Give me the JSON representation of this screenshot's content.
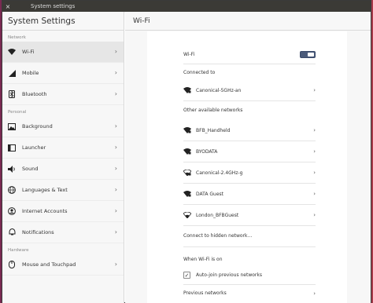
{
  "window": {
    "title": "System settings",
    "close_glyph": "×"
  },
  "left_panel": {
    "title": "System Settings",
    "sections": [
      {
        "label": "Network",
        "items": [
          {
            "label": "Wi-Fi",
            "icon": "wifi-icon",
            "selected": true
          },
          {
            "label": "Mobile",
            "icon": "signal-bars-icon"
          },
          {
            "label": "Bluetooth",
            "icon": "bluetooth-icon"
          }
        ]
      },
      {
        "label": "Personal",
        "items": [
          {
            "label": "Background",
            "icon": "image-icon"
          },
          {
            "label": "Launcher",
            "icon": "launcher-icon"
          },
          {
            "label": "Sound",
            "icon": "speaker-icon"
          },
          {
            "label": "Languages & Text",
            "icon": "globe-icon"
          },
          {
            "label": "Internet Accounts",
            "icon": "accounts-icon"
          },
          {
            "label": "Notifications",
            "icon": "notification-icon"
          }
        ]
      },
      {
        "label": "Hardware",
        "items": [
          {
            "label": "Mouse and Touchpad",
            "icon": "mouse-icon"
          }
        ]
      }
    ]
  },
  "right_panel": {
    "title": "Wi-Fi",
    "wifi_label": "Wi-Fi",
    "wifi_enabled": true,
    "connected_header": "Connected to",
    "connected_network": "Canonical-5GHz-an",
    "other_header": "Other available networks",
    "networks": [
      "BFB_Handheld",
      "BYODATA",
      "Canonical-2.4GHz-g",
      "DATA Guest",
      "London_BFBGuest"
    ],
    "hidden_network_label": "Connect to hidden network…",
    "when_on_header": "When Wi-Fi is on",
    "auto_join_label": "Auto-join previous networks",
    "auto_join_checked": true,
    "previous_networks_label": "Previous networks"
  },
  "colors": {
    "toggle_on": "#4a5a7a",
    "titlebar": "#3b3a36",
    "selected_row": "#e6e6e6"
  }
}
